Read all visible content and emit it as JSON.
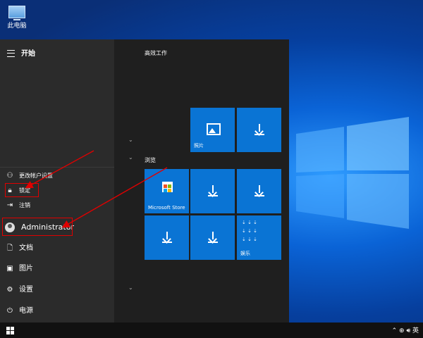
{
  "desktop": {
    "icon_label": "此电脑"
  },
  "start": {
    "title": "开始",
    "popup": [
      {
        "label": "更改帐户设置",
        "icon": "person-gear-icon"
      },
      {
        "label": "锁定",
        "icon": "lock-icon"
      },
      {
        "label": "注销",
        "icon": "sign-out-icon"
      }
    ],
    "user": "Administrator",
    "rail": [
      {
        "label": "文档",
        "icon": "document-icon"
      },
      {
        "label": "图片",
        "icon": "pictures-icon"
      },
      {
        "label": "设置",
        "icon": "gear-icon"
      },
      {
        "label": "电源",
        "icon": "power-icon"
      }
    ],
    "groups": {
      "productivity": "高效工作",
      "browse": "浏览"
    },
    "tiles": {
      "photos": "照片",
      "store": "Microsoft Store",
      "entertainment": "娱乐"
    }
  },
  "tray": {
    "ime": "英"
  },
  "colors": {
    "tile": "#0a74d4",
    "annotation": "#e00000",
    "menu": "#2b2b2b"
  }
}
